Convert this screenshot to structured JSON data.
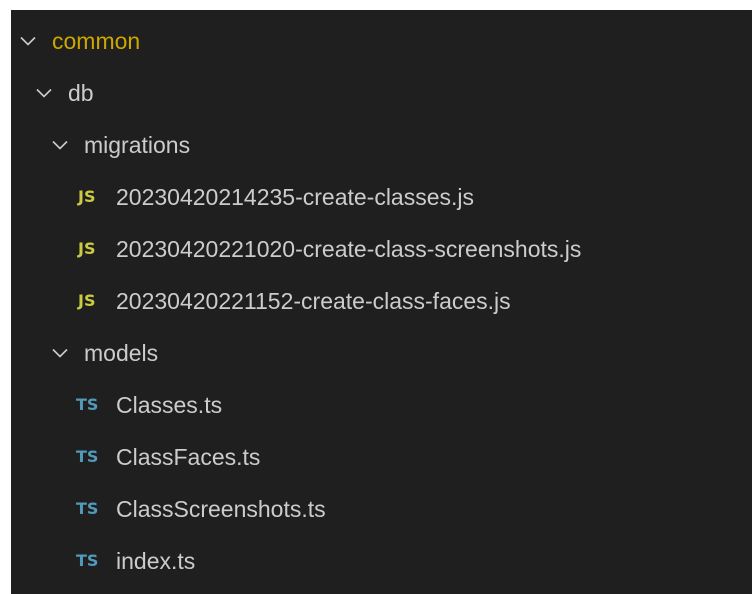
{
  "explorer": {
    "colors": {
      "background": "#1f1f1f",
      "text": "#cccccc",
      "root_folder": "#cca700",
      "js_badge": "#cbcb41",
      "ts_badge": "#519aba"
    },
    "folders": {
      "common": {
        "label": "common",
        "expanded": true
      },
      "db": {
        "label": "db",
        "expanded": true
      },
      "migrations": {
        "label": "migrations",
        "expanded": true
      },
      "models": {
        "label": "models",
        "expanded": true
      }
    },
    "migrations": [
      {
        "badge": "JS",
        "name": "20230420214235-create-classes.js"
      },
      {
        "badge": "JS",
        "name": "20230420221020-create-class-screenshots.js"
      },
      {
        "badge": "JS",
        "name": "20230420221152-create-class-faces.js"
      }
    ],
    "models": [
      {
        "badge": "TS",
        "name": "Classes.ts"
      },
      {
        "badge": "TS",
        "name": "ClassFaces.ts"
      },
      {
        "badge": "TS",
        "name": "ClassScreenshots.ts"
      },
      {
        "badge": "TS",
        "name": "index.ts"
      }
    ]
  }
}
